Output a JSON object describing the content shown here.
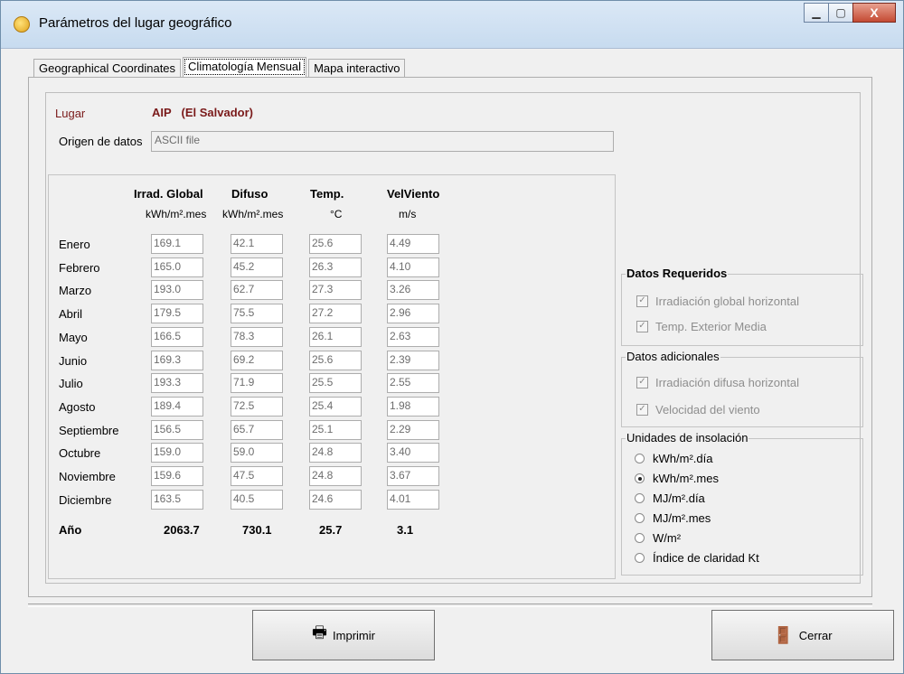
{
  "window": {
    "title": "Parámetros del lugar geográfico",
    "minimize": "▁",
    "maximize": "▢",
    "close": "X"
  },
  "tabs": [
    "Geographical Coordinates",
    "Climatología Mensual",
    "Mapa interactivo"
  ],
  "lugar": {
    "label": "Lugar",
    "code": "AIP",
    "country": "(El Salvador)"
  },
  "origen": {
    "label": "Origen de datos",
    "value": "ASCII file"
  },
  "columns": [
    {
      "header": "Irrad. Global",
      "unit": "kWh/m².mes"
    },
    {
      "header": "Difuso",
      "unit": "kWh/m².mes"
    },
    {
      "header": "Temp.",
      "unit": "°C"
    },
    {
      "header": "VelViento",
      "unit": "m/s"
    }
  ],
  "rows": [
    {
      "month": "Enero",
      "values": [
        "169.1",
        "42.1",
        "25.6",
        "4.49"
      ]
    },
    {
      "month": "Febrero",
      "values": [
        "165.0",
        "45.2",
        "26.3",
        "4.10"
      ]
    },
    {
      "month": "Marzo",
      "values": [
        "193.0",
        "62.7",
        "27.3",
        "3.26"
      ]
    },
    {
      "month": "Abril",
      "values": [
        "179.5",
        "75.5",
        "27.2",
        "2.96"
      ]
    },
    {
      "month": "Mayo",
      "values": [
        "166.5",
        "78.3",
        "26.1",
        "2.63"
      ]
    },
    {
      "month": "Junio",
      "values": [
        "169.3",
        "69.2",
        "25.6",
        "2.39"
      ]
    },
    {
      "month": "Julio",
      "values": [
        "193.3",
        "71.9",
        "25.5",
        "2.55"
      ]
    },
    {
      "month": "Agosto",
      "values": [
        "189.4",
        "72.5",
        "25.4",
        "1.98"
      ]
    },
    {
      "month": "Septiembre",
      "values": [
        "156.5",
        "65.7",
        "25.1",
        "2.29"
      ]
    },
    {
      "month": "Octubre",
      "values": [
        "159.0",
        "59.0",
        "24.8",
        "3.40"
      ]
    },
    {
      "month": "Noviembre",
      "values": [
        "159.6",
        "47.5",
        "24.8",
        "3.67"
      ]
    },
    {
      "month": "Diciembre",
      "values": [
        "163.5",
        "40.5",
        "24.6",
        "4.01"
      ]
    }
  ],
  "year": {
    "label": "Año",
    "values": [
      "2063.7",
      "730.1",
      "25.7",
      "3.1"
    ]
  },
  "datos_requeridos": {
    "title": "Datos Requeridos",
    "items": [
      "Irradiación global horizontal",
      "Temp. Exterior Media"
    ]
  },
  "datos_adicionales": {
    "title": "Datos adicionales",
    "items": [
      "Irradiación difusa horizontal",
      "Velocidad del viento"
    ]
  },
  "unidades": {
    "title": "Unidades de insolación",
    "options": [
      "kWh/m².día",
      "kWh/m².mes",
      "MJ/m².día",
      "MJ/m².mes",
      "W/m²",
      "Índice de claridad Kt"
    ],
    "selected_index": 1
  },
  "buttons": {
    "print": "Imprimir",
    "close": "Cerrar",
    "print_icon": "printer-icon",
    "close_icon": "exit-door-icon"
  }
}
